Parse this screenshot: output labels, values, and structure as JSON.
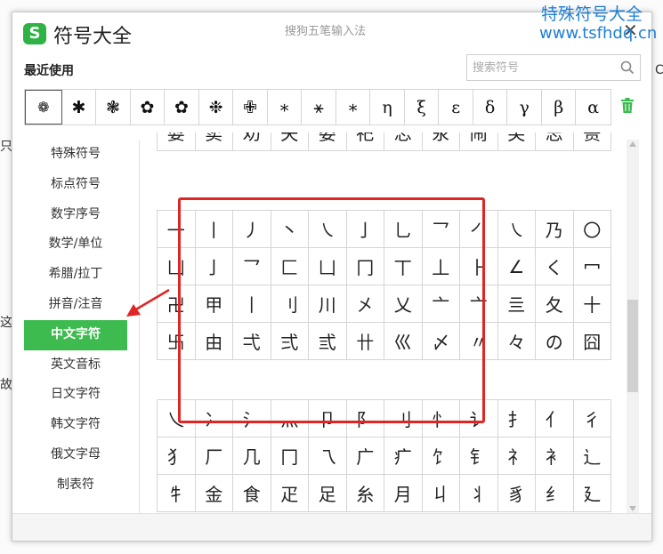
{
  "window": {
    "title": "符号大全",
    "subtitle": "搜狗五笔输入法",
    "close": "✕",
    "logo": "S"
  },
  "background": {
    "left_text": [
      "只",
      "这",
      "故"
    ],
    "right_text": "C"
  },
  "watermark": {
    "line1": "特殊符号大全",
    "line2": "www.tsfhdq.cn"
  },
  "recent": {
    "label": "最近使用",
    "symbols": [
      "❁",
      "✱",
      "❃",
      "✿",
      "✿",
      "❉",
      "✙",
      "∗",
      "⚹",
      "∗",
      "η",
      "ξ",
      "ε",
      "δ",
      "γ",
      "β",
      "α"
    ]
  },
  "search": {
    "placeholder": "搜索符号"
  },
  "sidebar": {
    "items": [
      {
        "label": "特殊符号"
      },
      {
        "label": "标点符号"
      },
      {
        "label": "数字序号"
      },
      {
        "label": "数学/单位"
      },
      {
        "label": "希腊/拉丁"
      },
      {
        "label": "拼音/注音"
      },
      {
        "label": "中文字符"
      },
      {
        "label": "英文音标"
      },
      {
        "label": "日文字符"
      },
      {
        "label": "韩文字符"
      },
      {
        "label": "俄文字母"
      },
      {
        "label": "制表符"
      }
    ],
    "active_index": 6
  },
  "symbol_grids": [
    {
      "rows": [
        [
          "耍",
          "荬",
          "劝",
          "夬",
          "娄",
          "祀",
          "忐",
          "汆",
          "闹",
          "芙",
          "志",
          "蒉"
        ]
      ]
    },
    {
      "rows": [
        [
          "一",
          "丨",
          "丿",
          "丶",
          "㇏",
          "亅",
          "乚",
          "乛",
          "㇒",
          "㇏",
          "乃",
          "〇"
        ],
        [
          "凵",
          "亅",
          "乛",
          "匚",
          "凵",
          "冂",
          "丅",
          "丄",
          "⺊",
          "∠",
          "く",
          "冖"
        ],
        [
          "卍",
          "甲",
          "丨",
          "刂",
          "川",
          "㐅",
          "乂",
          "亠",
          "亠",
          "亖",
          "夂",
          "十"
        ],
        [
          "卐",
          "由",
          "弌",
          "弍",
          "弎",
          "卄",
          "巛",
          "〆",
          "〃",
          "々",
          "の",
          "囧"
        ]
      ]
    },
    {
      "rows": [
        [
          "乀",
          "冫",
          "氵",
          "灬",
          "卩",
          "阝",
          "刂",
          "忄",
          "讠",
          "扌",
          "亻",
          "彳"
        ],
        [
          "犭",
          "厂",
          "几",
          "冂",
          "乁",
          "广",
          "疒",
          "饣",
          "钅",
          "礻",
          "衤",
          "辶"
        ],
        [
          "牜",
          "金",
          "食",
          "疋",
          "足",
          "糸",
          "月",
          "丩",
          "丬",
          "豸",
          "纟",
          "廴"
        ]
      ]
    }
  ]
}
